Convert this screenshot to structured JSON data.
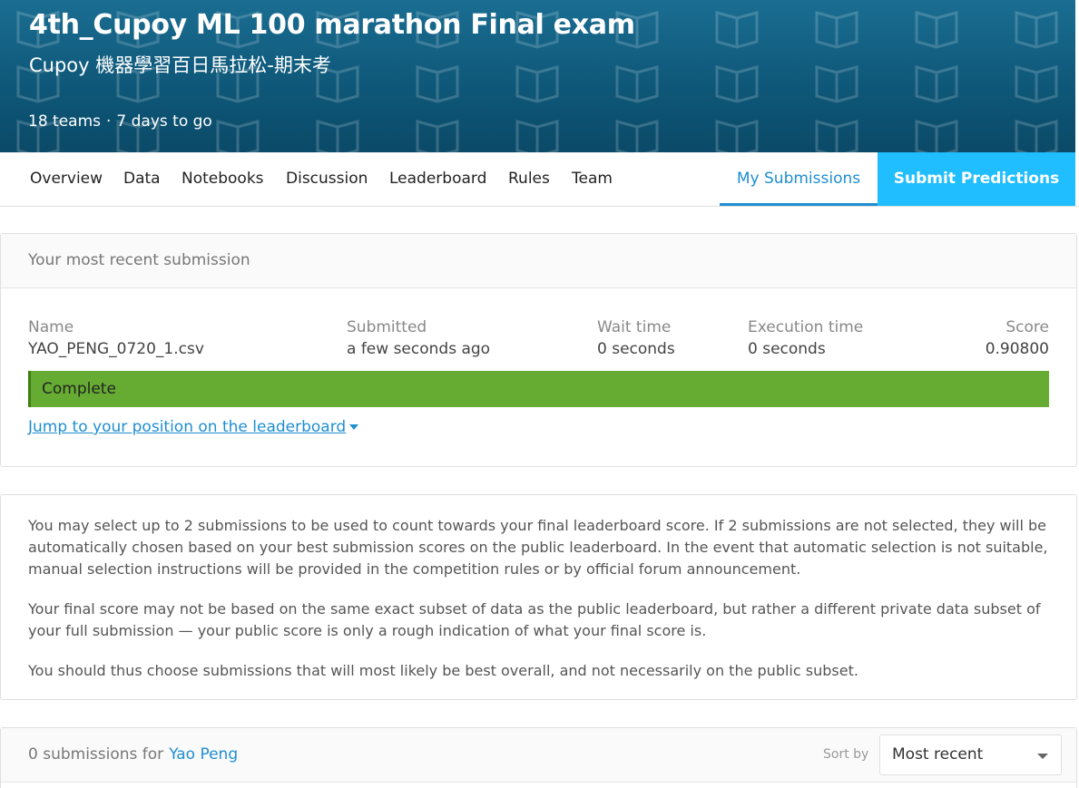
{
  "banner": {
    "title": "4th_Cupoy ML 100 marathon Final exam",
    "subtitle": "Cupoy 機器學習百日馬拉松-期末考",
    "teams": "18 teams",
    "separator": "·",
    "deadline": "7 days to go"
  },
  "nav": {
    "items": [
      "Overview",
      "Data",
      "Notebooks",
      "Discussion",
      "Leaderboard",
      "Rules",
      "Team"
    ],
    "my_submissions": "My Submissions",
    "submit_predictions": "Submit Predictions"
  },
  "recent": {
    "header": "Your most recent submission",
    "name_label": "Name",
    "name_value": "YAO_PENG_0720_1.csv",
    "submitted_label": "Submitted",
    "submitted_value": "a few seconds ago",
    "wait_label": "Wait time",
    "wait_value": "0 seconds",
    "exec_label": "Execution time",
    "exec_value": "0 seconds",
    "score_label": "Score",
    "score_value": "0.90800",
    "status": "Complete",
    "status_color": "#66ac33",
    "jump_link": "Jump to your position on the leaderboard"
  },
  "info": {
    "p1": "You may select up to 2 submissions to be used to count towards your final leaderboard score. If 2 submissions are not selected, they will be automatically chosen based on your best submission scores on the public leaderboard. In the event that automatic selection is not suitable, manual selection instructions will be provided in the competition rules or by official forum announcement.",
    "p2": "Your final score may not be based on the same exact subset of data as the public leaderboard, but rather a different private data subset of your full submission — your public score is only a rough indication of what your final score is.",
    "p3": "You should thus choose submissions that will most likely be best overall, and not necessarily on the public subset."
  },
  "submissions": {
    "count_text": "0 submissions for",
    "user": "Yao Peng",
    "sort_label": "Sort by",
    "sort_value": "Most recent"
  },
  "colors": {
    "accent": "#1e8ed1",
    "submit_bg": "#20beff",
    "banner": "#0e5677"
  }
}
